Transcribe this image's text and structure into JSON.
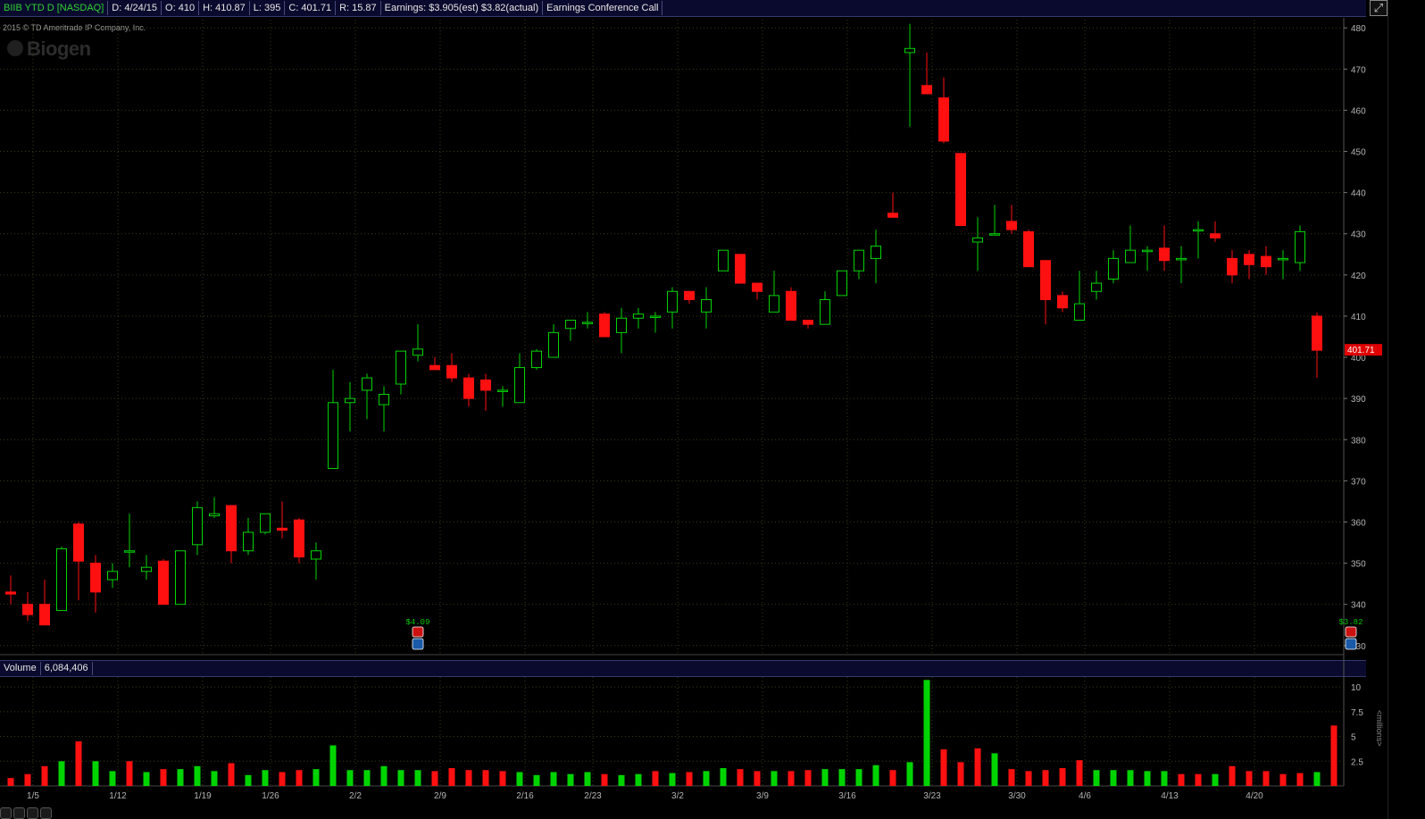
{
  "header": {
    "symbol": "BIIB YTD D [NASDAQ]",
    "date": "D: 4/24/15",
    "open": "O: 410",
    "high": "H: 410.87",
    "low": "L: 395",
    "close": "C: 401.71",
    "range": "R: 15.87",
    "earnings": "Earnings: $3.905(est) $3.82(actual)",
    "event": "Earnings Conference Call"
  },
  "copyright": "2015 © TD Ameritrade IP Company, Inc.",
  "logo_text": "Biogen",
  "volume_header": {
    "label": "Volume",
    "value": "6,084,406"
  },
  "millions_label": "<millions>",
  "last_price_label": "401.71",
  "earnings_markers": [
    {
      "label": "$4.09",
      "index": 24
    },
    {
      "label": "$3.82",
      "index": 79
    }
  ],
  "colors": {
    "up": "#00d400",
    "down": "#ff1010",
    "grid": "#3a3a1a",
    "axis_text": "#b4b4b4",
    "price_tag": "#e00000"
  },
  "chart_data": [
    {
      "type": "candlestick",
      "title": "",
      "ylim": [
        328,
        482
      ],
      "yticks": [
        330,
        340,
        350,
        360,
        370,
        380,
        390,
        400,
        410,
        420,
        430,
        440,
        450,
        460,
        470,
        480
      ],
      "xtick_labels": [
        {
          "label": "1/5",
          "index": 1
        },
        {
          "label": "1/12",
          "index": 6
        },
        {
          "label": "1/19",
          "index": 11
        },
        {
          "label": "1/26",
          "index": 15
        },
        {
          "label": "2/2",
          "index": 20
        },
        {
          "label": "2/9",
          "index": 25
        },
        {
          "label": "2/16",
          "index": 30
        },
        {
          "label": "2/23",
          "index": 34
        },
        {
          "label": "3/2",
          "index": 39
        },
        {
          "label": "3/9",
          "index": 44
        },
        {
          "label": "3/16",
          "index": 49
        },
        {
          "label": "3/23",
          "index": 54
        },
        {
          "label": "3/30",
          "index": 59
        },
        {
          "label": "4/6",
          "index": 63
        },
        {
          "label": "4/13",
          "index": 68
        },
        {
          "label": "4/20",
          "index": 73
        }
      ],
      "candles": [
        {
          "o": 343,
          "h": 347,
          "l": 340,
          "c": 342.5
        },
        {
          "o": 340,
          "h": 343,
          "l": 336,
          "c": 337.5
        },
        {
          "o": 340,
          "h": 346,
          "l": 335,
          "c": 335
        },
        {
          "o": 338.5,
          "h": 354,
          "l": 338.5,
          "c": 353.5
        },
        {
          "o": 359.5,
          "h": 360,
          "l": 341,
          "c": 350.5
        },
        {
          "o": 350,
          "h": 352,
          "l": 338,
          "c": 343
        },
        {
          "o": 346,
          "h": 350,
          "l": 344,
          "c": 348
        },
        {
          "o": 353,
          "h": 362,
          "l": 349,
          "c": 353
        },
        {
          "o": 348,
          "h": 352,
          "l": 346,
          "c": 349
        },
        {
          "o": 350.5,
          "h": 351,
          "l": 340,
          "c": 340
        },
        {
          "o": 340,
          "h": 353,
          "l": 340,
          "c": 353
        },
        {
          "o": 354.5,
          "h": 365,
          "l": 352,
          "c": 363.5
        },
        {
          "o": 361.5,
          "h": 366,
          "l": 361,
          "c": 362
        },
        {
          "o": 364,
          "h": 364,
          "l": 350,
          "c": 353
        },
        {
          "o": 353,
          "h": 361,
          "l": 352,
          "c": 357.5
        },
        {
          "o": 357.5,
          "h": 362,
          "l": 357,
          "c": 362
        },
        {
          "o": 358.5,
          "h": 365,
          "l": 356,
          "c": 358
        },
        {
          "o": 360.5,
          "h": 361,
          "l": 350,
          "c": 351.5
        },
        {
          "o": 351,
          "h": 355,
          "l": 346,
          "c": 353
        },
        {
          "o": 373,
          "h": 397,
          "l": 373,
          "c": 389
        },
        {
          "o": 389,
          "h": 394,
          "l": 382,
          "c": 390
        },
        {
          "o": 392,
          "h": 396,
          "l": 385,
          "c": 395
        },
        {
          "o": 388.5,
          "h": 393,
          "l": 382,
          "c": 391
        },
        {
          "o": 393.5,
          "h": 401,
          "l": 391,
          "c": 401.5
        },
        {
          "o": 400.5,
          "h": 408,
          "l": 399,
          "c": 402
        },
        {
          "o": 398,
          "h": 400,
          "l": 397,
          "c": 397
        },
        {
          "o": 398,
          "h": 401,
          "l": 394,
          "c": 395
        },
        {
          "o": 395,
          "h": 396,
          "l": 388,
          "c": 390
        },
        {
          "o": 394.5,
          "h": 396,
          "l": 387,
          "c": 392
        },
        {
          "o": 392,
          "h": 393,
          "l": 388,
          "c": 392
        },
        {
          "o": 389,
          "h": 401,
          "l": 389,
          "c": 397.5
        },
        {
          "o": 397.5,
          "h": 402,
          "l": 397,
          "c": 401.5
        },
        {
          "o": 400,
          "h": 408,
          "l": 400,
          "c": 406
        },
        {
          "o": 407,
          "h": 409,
          "l": 404,
          "c": 409
        },
        {
          "o": 408.5,
          "h": 411,
          "l": 407,
          "c": 408.5
        },
        {
          "o": 410.5,
          "h": 411,
          "l": 405,
          "c": 405
        },
        {
          "o": 406,
          "h": 412,
          "l": 401,
          "c": 409.5
        },
        {
          "o": 409.5,
          "h": 412,
          "l": 407,
          "c": 410.5
        },
        {
          "o": 410,
          "h": 411,
          "l": 406,
          "c": 410
        },
        {
          "o": 411,
          "h": 417,
          "l": 407,
          "c": 416
        },
        {
          "o": 416,
          "h": 416,
          "l": 413,
          "c": 414
        },
        {
          "o": 411,
          "h": 417,
          "l": 407,
          "c": 414
        },
        {
          "o": 421,
          "h": 426,
          "l": 421,
          "c": 426
        },
        {
          "o": 425,
          "h": 425,
          "l": 418,
          "c": 418
        },
        {
          "o": 418,
          "h": 417,
          "l": 414,
          "c": 416
        },
        {
          "o": 411,
          "h": 421,
          "l": 411,
          "c": 415
        },
        {
          "o": 416,
          "h": 417,
          "l": 409,
          "c": 409
        },
        {
          "o": 409,
          "h": 409,
          "l": 407,
          "c": 408
        },
        {
          "o": 408,
          "h": 416,
          "l": 408,
          "c": 414
        },
        {
          "o": 415,
          "h": 421,
          "l": 415,
          "c": 421
        },
        {
          "o": 421,
          "h": 426,
          "l": 419,
          "c": 426
        },
        {
          "o": 424,
          "h": 431,
          "l": 418,
          "c": 427
        },
        {
          "o": 435,
          "h": 440,
          "l": 435,
          "c": 434
        },
        {
          "o": 474,
          "h": 481,
          "l": 456,
          "c": 475
        },
        {
          "o": 466,
          "h": 474,
          "l": 464,
          "c": 464
        },
        {
          "o": 463,
          "h": 468,
          "l": 452,
          "c": 452.5
        },
        {
          "o": 449.5,
          "h": 449.5,
          "l": 432,
          "c": 432
        },
        {
          "o": 428,
          "h": 434,
          "l": 421,
          "c": 429
        },
        {
          "o": 430,
          "h": 437,
          "l": 430,
          "c": 430
        },
        {
          "o": 433,
          "h": 437,
          "l": 430,
          "c": 431
        },
        {
          "o": 430.5,
          "h": 431,
          "l": 422,
          "c": 422
        },
        {
          "o": 423.5,
          "h": 423.5,
          "l": 408,
          "c": 414
        },
        {
          "o": 415,
          "h": 416,
          "l": 411,
          "c": 412
        },
        {
          "o": 409,
          "h": 421,
          "l": 409,
          "c": 413
        },
        {
          "o": 416,
          "h": 421,
          "l": 414,
          "c": 418
        },
        {
          "o": 419,
          "h": 426,
          "l": 418,
          "c": 424
        },
        {
          "o": 423,
          "h": 432,
          "l": 423,
          "c": 426
        },
        {
          "o": 426,
          "h": 427,
          "l": 421,
          "c": 426
        },
        {
          "o": 426.5,
          "h": 432,
          "l": 421,
          "c": 423.5
        },
        {
          "o": 424,
          "h": 427,
          "l": 418,
          "c": 424
        },
        {
          "o": 431,
          "h": 433,
          "l": 424,
          "c": 431
        },
        {
          "o": 430,
          "h": 433,
          "l": 428,
          "c": 429
        },
        {
          "o": 424,
          "h": 426,
          "l": 418,
          "c": 420
        },
        {
          "o": 425,
          "h": 426,
          "l": 419,
          "c": 422.5
        },
        {
          "o": 424.5,
          "h": 427,
          "l": 420,
          "c": 422
        },
        {
          "o": 424,
          "h": 426,
          "l": 419,
          "c": 424
        },
        {
          "o": 423,
          "h": 432,
          "l": 421,
          "c": 430.5
        },
        {
          "o": 410,
          "h": 410.87,
          "l": 395,
          "c": 401.71
        }
      ]
    },
    {
      "type": "bar",
      "title": "Volume",
      "ylabel": "<millions>",
      "ylim": [
        0,
        11
      ],
      "yticks": [
        2.5,
        5,
        7.5,
        10
      ],
      "values": [
        0.8,
        1.2,
        2,
        2.5,
        4.5,
        2.5,
        1.5,
        2.5,
        1.4,
        1.7,
        1.7,
        2,
        1.5,
        2.3,
        1.1,
        1.6,
        1.4,
        1.6,
        1.7,
        4.1,
        1.6,
        1.6,
        2,
        1.6,
        1.6,
        1.5,
        1.8,
        1.6,
        1.6,
        1.5,
        1.4,
        1.1,
        1.4,
        1.2,
        1.4,
        1.2,
        1.1,
        1.2,
        1.5,
        1.3,
        1.4,
        1.5,
        1.8,
        1.7,
        1.5,
        1.5,
        1.5,
        1.6,
        1.7,
        1.7,
        1.7,
        2.1,
        1.6,
        2.4,
        10.7,
        3.7,
        2.4,
        3.8,
        3.3,
        1.7,
        1.5,
        1.6,
        1.8,
        2.6,
        1.6,
        1.6,
        1.6,
        1.5,
        1.5,
        1.2,
        1.2,
        1.2,
        2,
        1.5,
        1.5,
        1.2,
        1.3,
        1.4,
        6.1
      ],
      "up_flags": [
        false,
        false,
        false,
        true,
        false,
        true,
        true,
        false,
        true,
        false,
        true,
        true,
        true,
        false,
        true,
        true,
        false,
        false,
        true,
        true,
        true,
        true,
        true,
        true,
        true,
        false,
        false,
        false,
        false,
        false,
        true,
        true,
        true,
        true,
        true,
        false,
        true,
        true,
        false,
        true,
        false,
        true,
        true,
        false,
        false,
        true,
        false,
        false,
        true,
        true,
        true,
        true,
        false,
        true,
        true,
        false,
        false,
        false,
        true,
        false,
        false,
        false,
        false,
        false,
        true,
        true,
        true,
        true,
        true,
        false,
        false,
        true,
        false,
        false,
        false,
        false,
        false,
        true,
        false
      ]
    }
  ]
}
